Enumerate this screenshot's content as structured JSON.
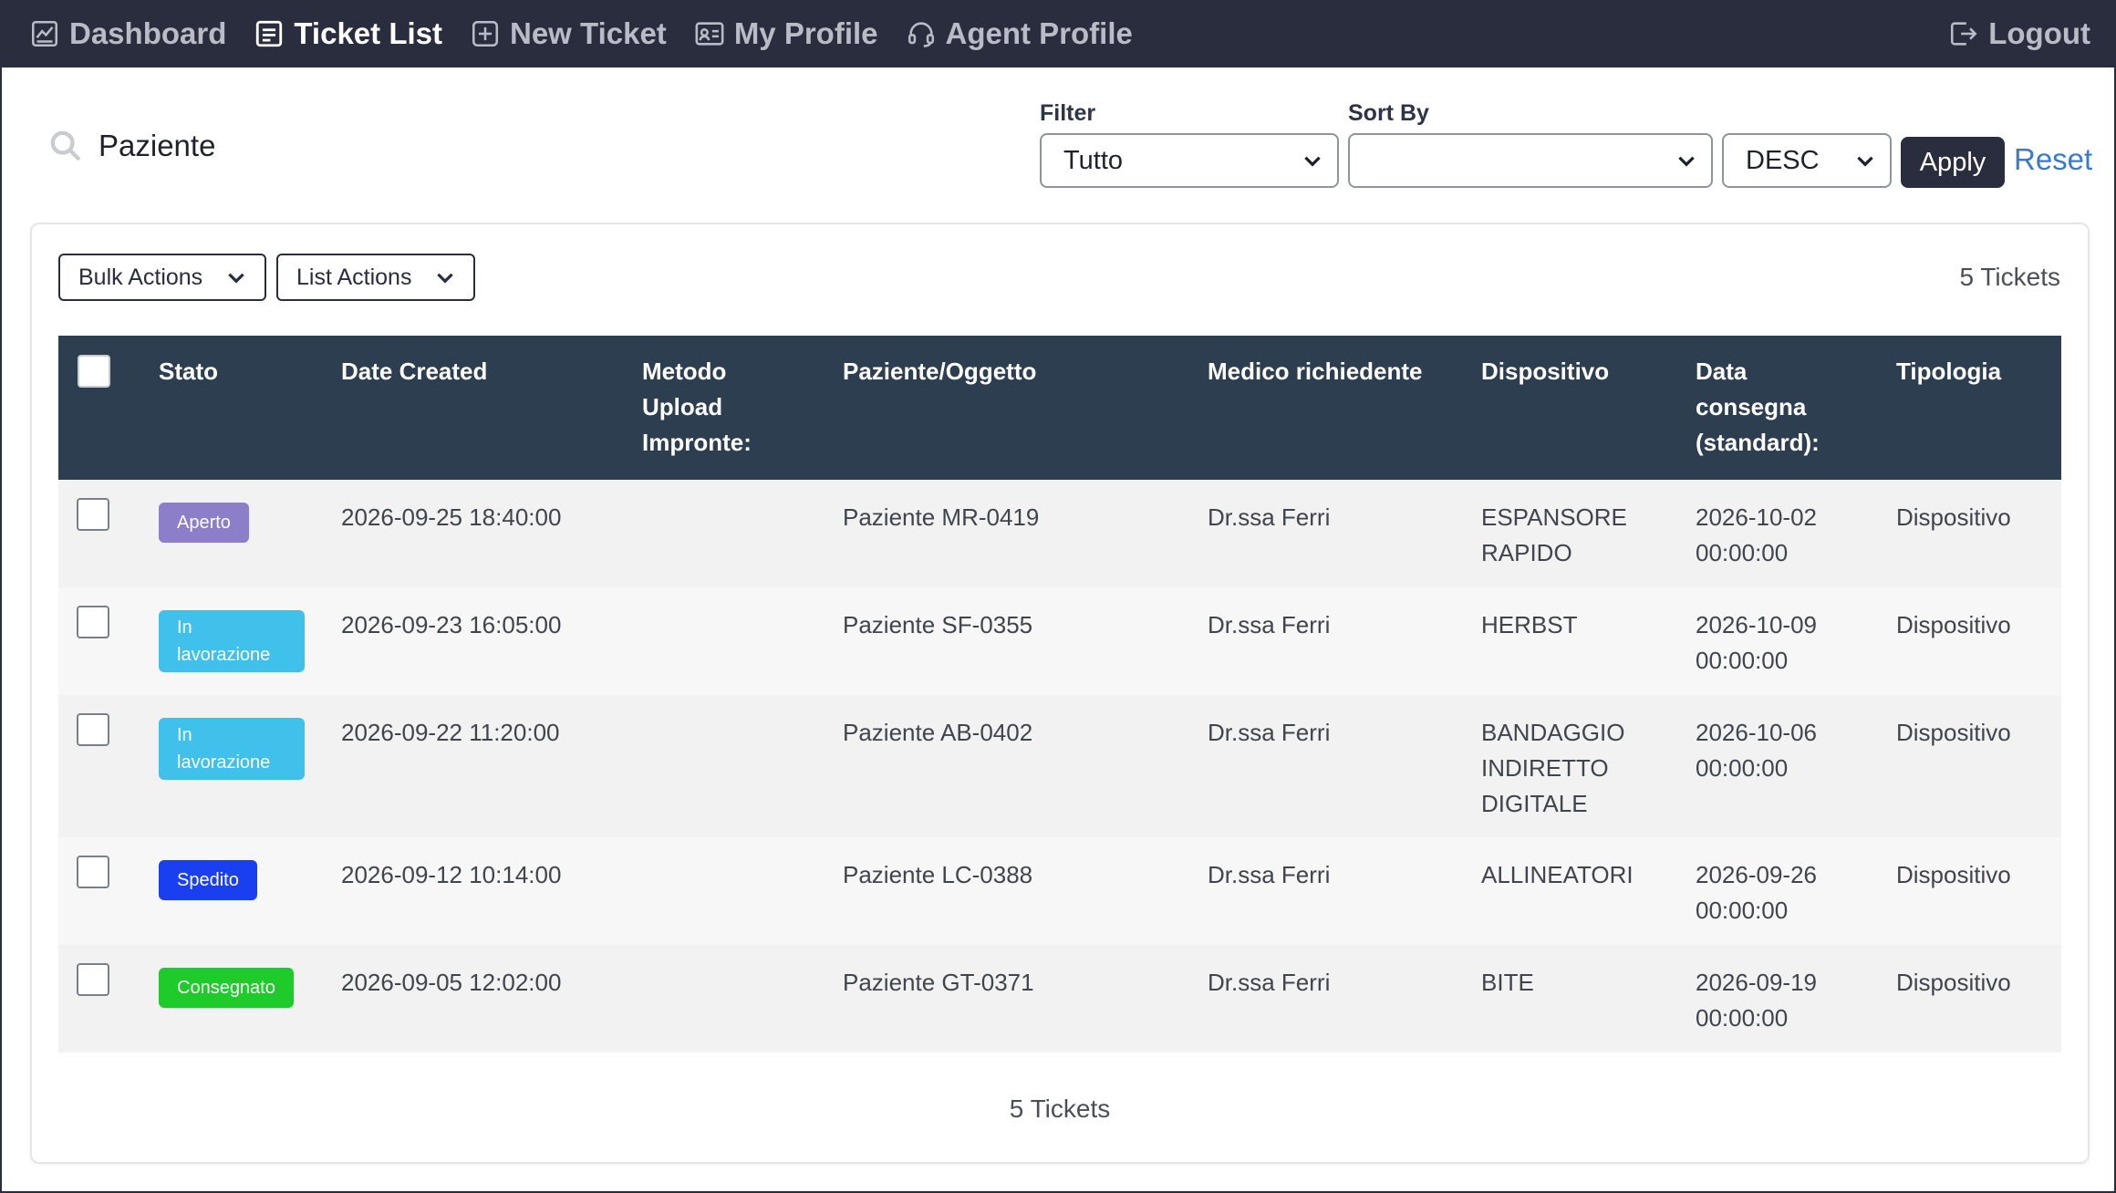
{
  "nav": {
    "items": [
      {
        "label": "Dashboard",
        "icon": "dashboard-icon",
        "active": false
      },
      {
        "label": "Ticket List",
        "icon": "list-icon",
        "active": true
      },
      {
        "label": "New Ticket",
        "icon": "plus-square-icon",
        "active": false
      },
      {
        "label": "My Profile",
        "icon": "id-card-icon",
        "active": false
      },
      {
        "label": "Agent Profile",
        "icon": "headset-icon",
        "active": false
      }
    ],
    "logout": "Logout"
  },
  "search": {
    "value": "Paziente",
    "placeholder": "Paziente"
  },
  "filter": {
    "label": "Filter",
    "value": "Tutto"
  },
  "sort": {
    "label": "Sort By",
    "value": "",
    "order": "DESC"
  },
  "apply_label": "Apply",
  "reset_label": "Reset",
  "card": {
    "bulk_actions": "Bulk Actions",
    "list_actions": "List Actions",
    "ticket_count": "5 Tickets"
  },
  "table": {
    "columns": [
      "Stato",
      "Date Created",
      "Metodo\nUpload\nImpronte:",
      "Paziente/Oggetto",
      "Medico richiedente",
      "Dispositivo",
      "Data\nconsegna\n(standard):",
      "Tipologia"
    ],
    "rows": [
      {
        "status": "Aperto",
        "status_color": "#8c7ec9",
        "date": "2026-09-25 18:40:00",
        "metodo": "",
        "paziente": "Paziente MR-0419",
        "medico": "Dr.ssa Ferri",
        "dispositivo": "ESPANSORE\nRAPIDO",
        "consegna": "2026-10-02\n00:00:00",
        "tipologia": "Dispositivo"
      },
      {
        "status": "In\nlavorazione",
        "status_color": "#3fc1ec",
        "date": "2026-09-23 16:05:00",
        "metodo": "",
        "paziente": "Paziente SF-0355",
        "medico": "Dr.ssa Ferri",
        "dispositivo": "HERBST",
        "consegna": "2026-10-09\n00:00:00",
        "tipologia": "Dispositivo"
      },
      {
        "status": "In\nlavorazione",
        "status_color": "#3fc1ec",
        "date": "2026-09-22 11:20:00",
        "metodo": "",
        "paziente": "Paziente AB-0402",
        "medico": "Dr.ssa Ferri",
        "dispositivo": "BANDAGGIO\nINDIRETTO\nDIGITALE",
        "consegna": "2026-10-06\n00:00:00",
        "tipologia": "Dispositivo"
      },
      {
        "status": "Spedito",
        "status_color": "#1a3ff0",
        "date": "2026-09-12 10:14:00",
        "metodo": "",
        "paziente": "Paziente LC-0388",
        "medico": "Dr.ssa Ferri",
        "dispositivo": "ALLINEATORI",
        "consegna": "2026-09-26\n00:00:00",
        "tipologia": "Dispositivo"
      },
      {
        "status": "Consegnato",
        "status_color": "#1ecb2a",
        "date": "2026-09-05 12:02:00",
        "metodo": "",
        "paziente": "Paziente GT-0371",
        "medico": "Dr.ssa Ferri",
        "dispositivo": "BITE",
        "consegna": "2026-09-19\n00:00:00",
        "tipologia": "Dispositivo"
      }
    ]
  },
  "colors": {
    "nav_bg": "#2a2d3e",
    "table_header_bg": "#2d3e50",
    "link": "#3a7bc8"
  }
}
